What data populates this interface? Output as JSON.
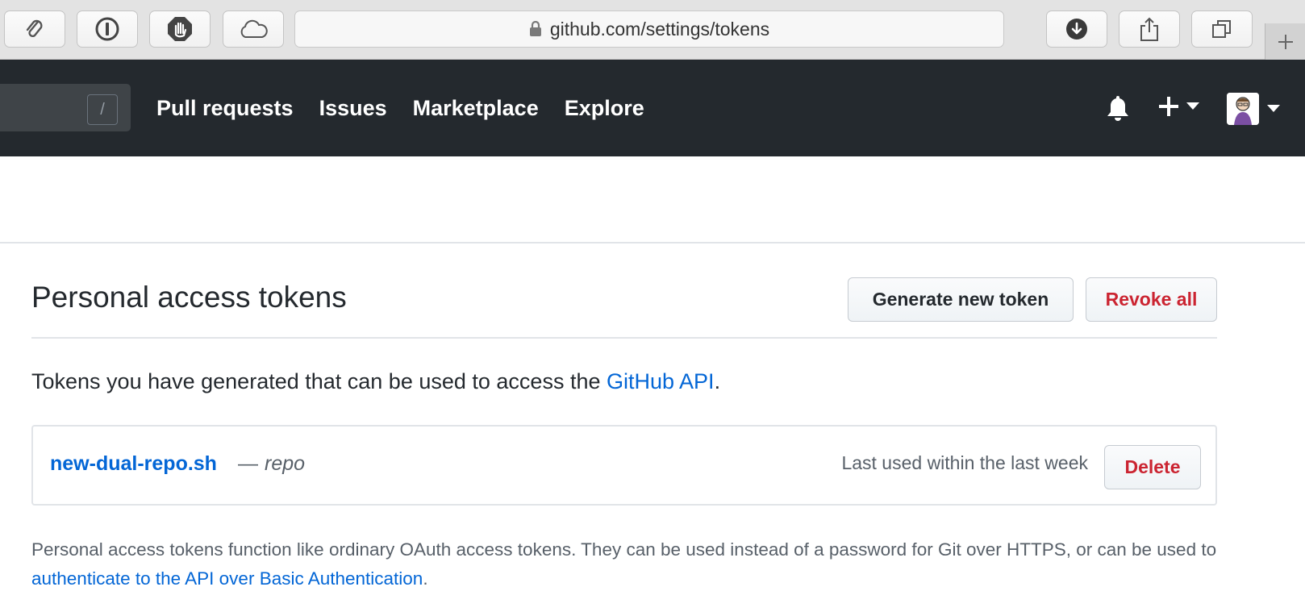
{
  "browser": {
    "url": "github.com/settings/tokens",
    "toolbar_icons": [
      "paperclip-icon",
      "1password-icon",
      "adblock-hand-icon",
      "cloud-icon",
      "download-icon",
      "share-icon",
      "tabs-icon",
      "new-tab-icon"
    ]
  },
  "header": {
    "search_shortcut": "/",
    "nav": [
      "Pull requests",
      "Issues",
      "Marketplace",
      "Explore"
    ]
  },
  "page": {
    "title": "Personal access tokens",
    "generate_label": "Generate new token",
    "revoke_label": "Revoke all",
    "intro_text": "Tokens you have generated that can be used to access the ",
    "intro_link": "GitHub API",
    "intro_end": ".",
    "token": {
      "name": "new-dual-repo.sh",
      "separator": "—",
      "scope": "repo",
      "last_used": "Last used within the last week",
      "delete_label": "Delete"
    },
    "note_text": "Personal access tokens function like ordinary OAuth access tokens. They can be used instead of a password for Git over HTTPS, or can be used to ",
    "note_link": "authenticate to the API over Basic Authentication",
    "note_end": "."
  },
  "colors": {
    "header_bg": "#24292e",
    "link": "#0366d6",
    "danger": "#cb2431"
  }
}
